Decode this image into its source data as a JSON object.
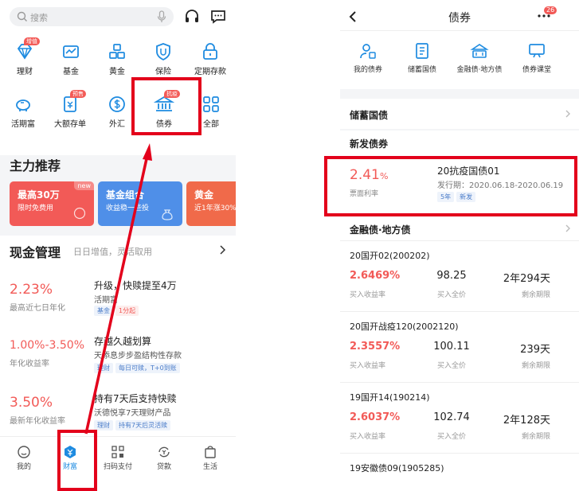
{
  "left": {
    "search": {
      "placeholder": "搜索"
    },
    "grid": [
      {
        "label": "理财",
        "icon": "diamond-icon",
        "tag": "增值"
      },
      {
        "label": "基金",
        "icon": "fund-icon"
      },
      {
        "label": "黄金",
        "icon": "gold-bars-icon"
      },
      {
        "label": "保险",
        "icon": "shield-icon"
      },
      {
        "label": "定期存款",
        "icon": "lock-icon"
      },
      {
        "label": "活期富",
        "icon": "piggy-bank-icon"
      },
      {
        "label": "大额存单",
        "icon": "certificate-icon",
        "tag": "预售"
      },
      {
        "label": "外汇",
        "icon": "dollar-coin-icon"
      },
      {
        "label": "债券",
        "icon": "bank-building-icon",
        "tag": "抗疫"
      },
      {
        "label": "全部",
        "icon": "apps-icon"
      }
    ],
    "main_recommend_title": "主力推荐",
    "promos": [
      {
        "title": "最高30万",
        "subtitle": "限时免费用",
        "badge": "new",
        "color": "#f25a57"
      },
      {
        "title": "基金组合",
        "subtitle": "收益稳一些投",
        "color": "#4f8fe8"
      },
      {
        "title": "黄金",
        "subtitle": "近1年涨30%",
        "color": "#f06a4a"
      }
    ],
    "cash": {
      "title": "现金管理",
      "subtitle": "日日增值，灵活取用",
      "rows": [
        {
          "rate": "2.23%",
          "rate_label": "最高近七日年化",
          "name": "升级，快赎提至4万",
          "sub": "活期富",
          "chips": [
            {
              "t": "基金",
              "r": false
            },
            {
              "t": "1分起",
              "r": true
            }
          ]
        },
        {
          "rate": "1.00%-3.50%",
          "rate_label": "年化收益率",
          "name": "存越久越划算",
          "sub": "天添息步步盈结构性存款",
          "chips": [
            {
              "t": "理财",
              "r": false
            },
            {
              "t": "每日可赎，T+0到账",
              "r": false
            }
          ]
        },
        {
          "rate": "3.50%",
          "rate_label": "最新年化收益率",
          "name": "持有7天后支持快赎",
          "sub": "沃德悦享7天理财产品",
          "chips": [
            {
              "t": "理财",
              "r": false
            },
            {
              "t": "持有7天后灵活赎",
              "r": false
            }
          ]
        }
      ]
    },
    "tabs": [
      {
        "label": "我的",
        "icon": "user-icon"
      },
      {
        "label": "财富",
        "icon": "wealth-icon"
      },
      {
        "label": "扫码支付",
        "icon": "qr-code-icon"
      },
      {
        "label": "贷款",
        "icon": "loan-icon"
      },
      {
        "label": "生活",
        "icon": "bag-icon"
      }
    ]
  },
  "right": {
    "title": "债券",
    "badge": "26",
    "grid": [
      {
        "label": "我的债券",
        "icon": "user-bond-icon"
      },
      {
        "label": "储蓄国债",
        "icon": "bond-doc-icon"
      },
      {
        "label": "金融债·地方债",
        "icon": "finance-bond-icon"
      },
      {
        "label": "债券课堂",
        "icon": "classroom-icon"
      }
    ],
    "savings_bond": "储蓄国债",
    "new_bond": {
      "section": "新发债券",
      "rate": "2.41",
      "unit": "%",
      "rate_label": "票面利率",
      "name": "20抗疫国债01",
      "period": "发行期：2020.06.18-2020.06.19",
      "tags": [
        "5年",
        "新发"
      ]
    },
    "finance_section": "金融债·地方债",
    "bonds": [
      {
        "name": "20国开02(200202)",
        "rate": "2.6469%",
        "price": "98.25",
        "term": "2年294天"
      },
      {
        "name": "20国开战疫120(2002120)",
        "rate": "2.3557%",
        "price": "100.11",
        "term": "239天"
      },
      {
        "name": "19国开14(190214)",
        "rate": "2.6037%",
        "price": "102.74",
        "term": "2年128天"
      }
    ],
    "bond_labels": {
      "rate": "买入收益率",
      "price": "买入全价",
      "term": "剩余期限"
    },
    "last_bond": "19安徽债09(1905285)"
  }
}
